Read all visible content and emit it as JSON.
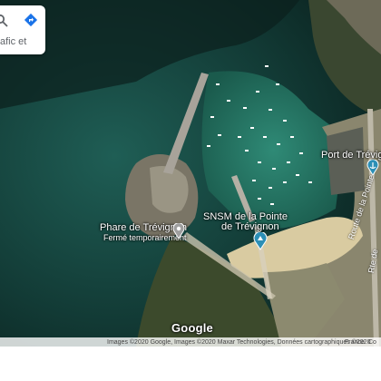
{
  "search": {
    "hint": "afic et",
    "search_icon": "search-icon",
    "directions_icon": "directions-icon"
  },
  "places": {
    "lighthouse_name": "Phare de Trévignon",
    "lighthouse_status": "Fermé temporairement",
    "sea_rescue_line1": "SNSM de la Pointe",
    "sea_rescue_line2": "de Trévignon",
    "port_name": "Port de Trévign"
  },
  "roads": {
    "road1": "Route de la Pointe",
    "road2": "Rte de"
  },
  "branding": {
    "logo": "Google"
  },
  "attribution": {
    "credits": "Images ©2020 Google, Images ©2020 Maxar Technologies, Données cartographiques ©2020",
    "region": "France",
    "extra": "Co"
  },
  "colors": {
    "deep_water": "#0d2a26",
    "shallow_water": "#1f6a5d",
    "harbor_water": "#2a7a68",
    "rock": "#6f6a5c",
    "sand": "#d8c9a0",
    "vegetation": "#3b4a2c",
    "pin": "#2c8fb6"
  }
}
